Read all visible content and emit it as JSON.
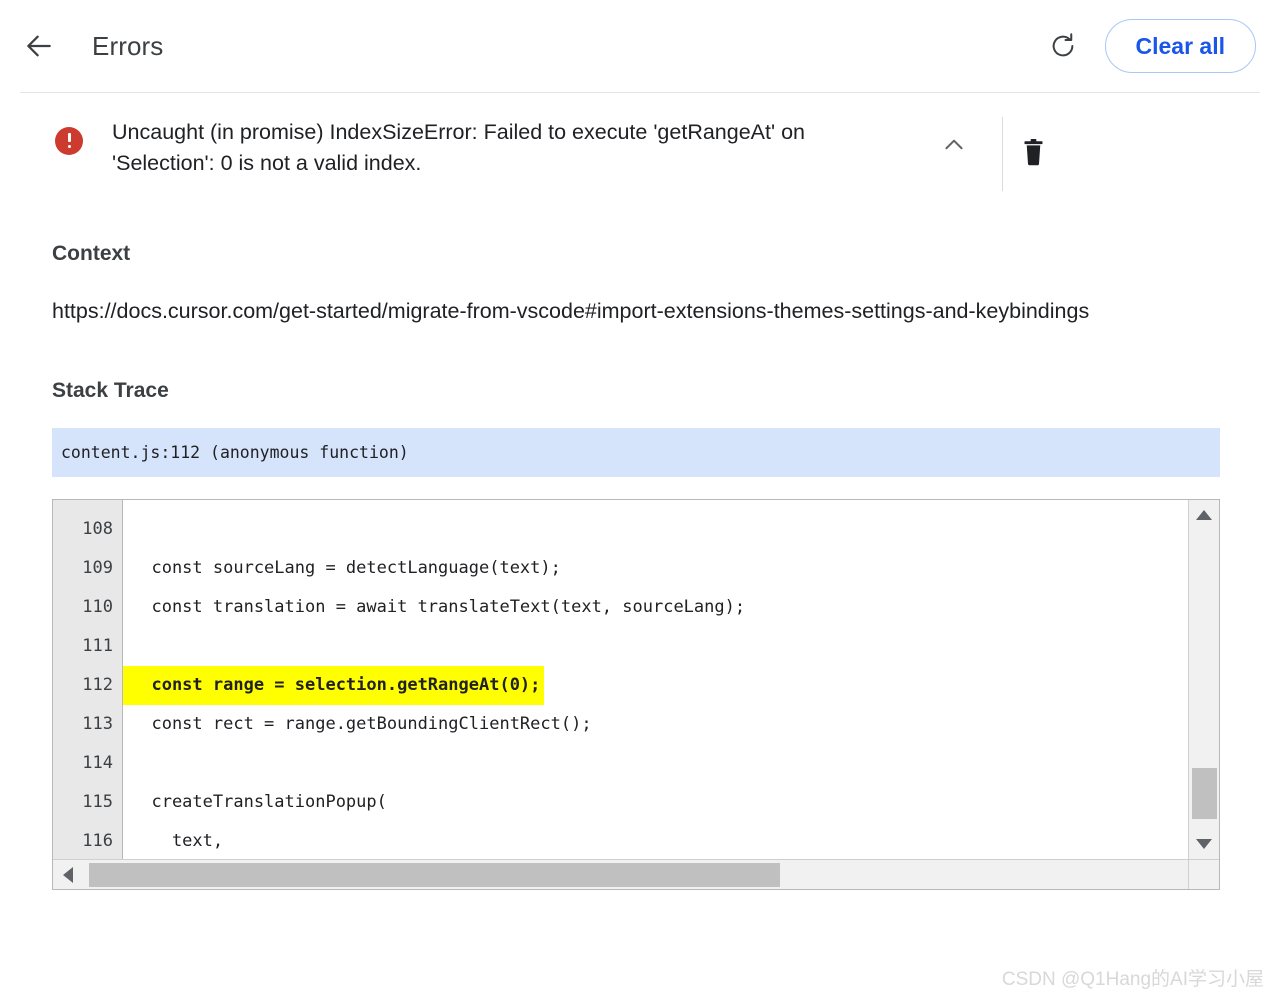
{
  "header": {
    "back_icon": "arrow-left-icon",
    "title": "Errors",
    "refresh_icon": "refresh-icon",
    "clear_all_label": "Clear all",
    "clear_all_text_color": "#1a56e8",
    "clear_all_border_color": "#a9c7f8"
  },
  "error": {
    "severity_icon": "error-circle-icon",
    "severity_color": "#cd3b2e",
    "message": "Uncaught (in promise) IndexSizeError: Failed to execute 'getRangeAt' on 'Selection': 0 is not a valid index.",
    "collapse_icon": "chevron-up-icon",
    "delete_icon": "trash-icon"
  },
  "context": {
    "heading": "Context",
    "url": "https://docs.cursor.com/get-started/migrate-from-vscode#import-extensions-themes-settings-and-keybindings"
  },
  "stack_trace": {
    "heading": "Stack Trace",
    "frame_label": "content.js:112 (anonymous function)",
    "frame_background": "#d5e3fb"
  },
  "code_viewer": {
    "highlight_color": "#ffff00",
    "gutter_background": "#e8e8e8",
    "highlighted_line": 112,
    "lines": [
      {
        "number": "108",
        "text": ""
      },
      {
        "number": "109",
        "text": "  const sourceLang = detectLanguage(text);"
      },
      {
        "number": "110",
        "text": "  const translation = await translateText(text, sourceLang);"
      },
      {
        "number": "111",
        "text": ""
      },
      {
        "number": "112",
        "text": "  const range = selection.getRangeAt(0);"
      },
      {
        "number": "113",
        "text": "  const rect = range.getBoundingClientRect();"
      },
      {
        "number": "114",
        "text": ""
      },
      {
        "number": "115",
        "text": "  createTranslationPopup("
      },
      {
        "number": "116",
        "text": "    text,"
      }
    ],
    "v_scroll_up_icon": "triangle-up-icon",
    "v_scroll_down_icon": "triangle-down-icon",
    "h_scroll_left_icon": "triangle-left-icon",
    "h_scroll_right_icon": "triangle-right-icon"
  },
  "watermark": {
    "text": "CSDN @Q1Hang的AI学习小屋"
  }
}
